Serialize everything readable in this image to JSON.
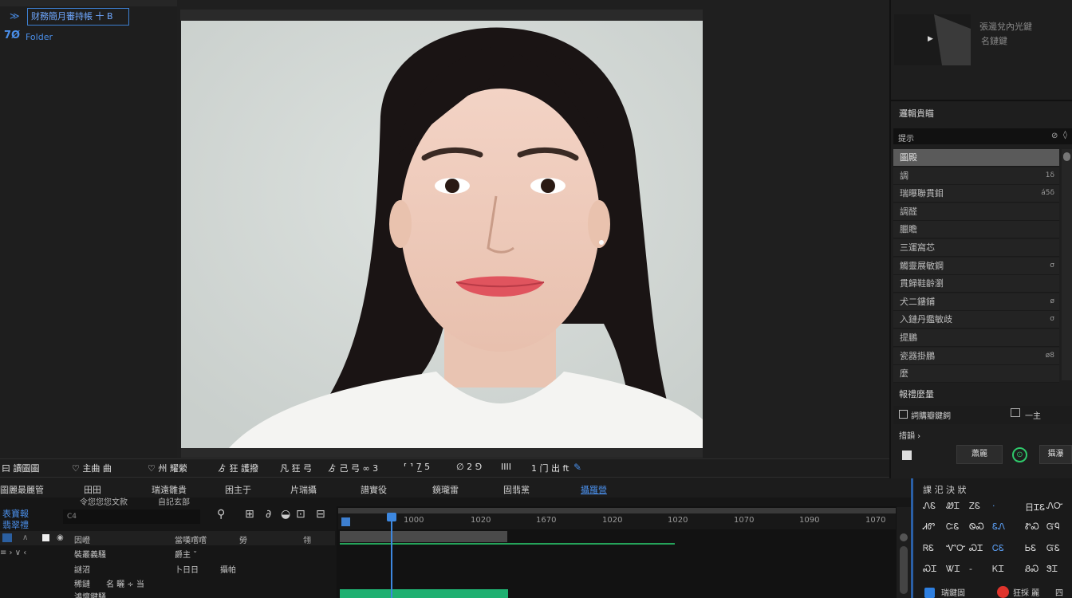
{
  "project_panel": {
    "title": "财務簡月審持帳 十 B",
    "title_icon": "≫",
    "sub_num": "7Ø",
    "sub_label": "Folder"
  },
  "thumbnail": {
    "line1": "張邊兌內光鍵",
    "line2": "名鏈鍵"
  },
  "effects": {
    "title": "邏輯貴瞄",
    "search_text": "提示",
    "items": [
      {
        "label": "圖殿",
        "num": "",
        "selected": true
      },
      {
        "label": "調",
        "num": "1δ",
        "selected": false
      },
      {
        "label": "瑞曝聯貫鉬",
        "num": "á5δ",
        "selected": false
      },
      {
        "label": "調醛",
        "num": "",
        "selected": false
      },
      {
        "label": "臘瞻",
        "num": "",
        "selected": false
      },
      {
        "label": "三運窩芯",
        "num": "",
        "selected": false
      },
      {
        "label": "觸靈展敏鋼",
        "num": "σ",
        "selected": false
      },
      {
        "label": "貫歸鞋齡瀏",
        "num": "",
        "selected": false
      },
      {
        "label": "犬二鏤鋪",
        "num": "ø",
        "selected": false
      },
      {
        "label": "入鏈丹鑑敏歧",
        "num": "σ",
        "selected": false
      },
      {
        "label": "提鵬",
        "num": "",
        "selected": false
      },
      {
        "label": "瓷器掛鵬",
        "num": "ø8",
        "selected": false
      },
      {
        "label": "麼",
        "num": "",
        "selected": false
      }
    ]
  },
  "properties": {
    "title": "報禮麼量",
    "row1_label": "詞購瓣鍵飼",
    "row1_value": "一主",
    "row2_label": "措韻 ›",
    "button1": "蕭麗",
    "ok_icon": "⊙",
    "button2": "攝瀑"
  },
  "toolbar": {
    "items": [
      "曰 讀圖圖",
      "♡ 主曲 曲",
      "♡ 州 耀縈",
      "ゟ 狂 護撥",
      "凡 狂 弓",
      "ゟ 己 弓 ∞ 3",
      "⸢ ⸣ 7̲ 5",
      "∅ 2 ⅁",
      "IIII",
      "1 门 出 ft"
    ]
  },
  "bottom_tabs": [
    {
      "label": "圖麗最麗管",
      "active": false
    },
    {
      "label": "田田",
      "active": false
    },
    {
      "label": "瑞遠雛貴",
      "active": false
    },
    {
      "label": "困主于",
      "active": false
    },
    {
      "label": "片瑞攝",
      "active": false
    },
    {
      "label": "譜實役",
      "active": false
    },
    {
      "label": "鏡瓏雷",
      "active": false
    },
    {
      "label": "固翡黨",
      "active": false
    },
    {
      "label": "攝羅營",
      "active": true
    }
  ],
  "bottom_sub": {
    "side_label1": "表寶報",
    "side_label2": "翡翠禮",
    "label_a": "令您您您文款",
    "label_b": "自記玄部",
    "tc_input": "C4"
  },
  "track_header": {
    "col1": "因嶝",
    "col2": "當嘆嚐嚐",
    "col3": "勞",
    "col4": "翎"
  },
  "tracks": [
    {
      "name": "裝叢義騷",
      "value": "爵主 ˘"
    },
    {
      "name": "謎沼",
      "value": "卜日日",
      "extra": "攝帕"
    },
    {
      "name": "稀鏈",
      "value": "名 曬 ∻ 当"
    },
    {
      "name": "鴻壇鍵騷",
      "value": ""
    }
  ],
  "timeline": {
    "ticks": [
      "1000",
      "1020",
      "1670",
      "1020",
      "1020",
      "1070",
      "1090",
      "1070"
    ]
  },
  "bottom_right": {
    "title": "課 汜 決 狀",
    "grid": [
      [
        "ᏁᏋ",
        "ᏪᏆ",
        "ᏃᏋ",
        "·",
        "日ᏆᏋ",
        "ᏁᏅ"
      ],
      [
        "ᏗᏛ",
        "ᏨᏋ",
        "ᏫᏍ",
        "ᏋᏁ",
        "ᏑᏍ",
        "ᏳᏄ"
      ],
      [
        "ᏒᏋ",
        "ᏉᏅ",
        "ᏍᏆ",
        "ᏟᏋ",
        "ᏏᏋ",
        "ᏳᏋ"
      ],
      [
        "ᏍᏆ",
        "ᏔᏆ",
        "-",
        "ᏦᏆ",
        "ᏰᏍ",
        "ᏕᏆ"
      ]
    ],
    "bottom_a": "瑞鍵固",
    "bottom_b": "狂採 麗",
    "bottom_c": "四"
  }
}
